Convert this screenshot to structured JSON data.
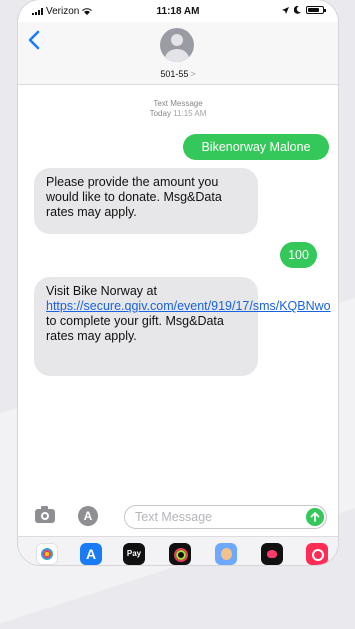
{
  "status_bar": {
    "carrier": "Verizon",
    "time": "11:18 AM",
    "battery_level": 0.75
  },
  "header": {
    "contact": "501-55",
    "contact_chevron": ">"
  },
  "thread": {
    "service_label": "Text Message",
    "timestamp_day": "Today",
    "timestamp_time": "11:15 AM",
    "messages": [
      {
        "direction": "outgoing",
        "text": "Bikenorway Malone"
      },
      {
        "direction": "incoming",
        "text": "Please provide the amount you would like to donate. Msg&Data rates may apply."
      },
      {
        "direction": "outgoing",
        "text": "100"
      },
      {
        "direction": "incoming",
        "prefix": "Visit Bike Norway at ",
        "link": "https://secure.qgiv.com/event/919/17/sms/KQBNwo",
        "suffix": " to complete your gift. Msg&Data rates may apply."
      }
    ]
  },
  "composer": {
    "placeholder": "Text Message",
    "value": ""
  },
  "drawer": {
    "apple_pay_label": "Pay"
  }
}
